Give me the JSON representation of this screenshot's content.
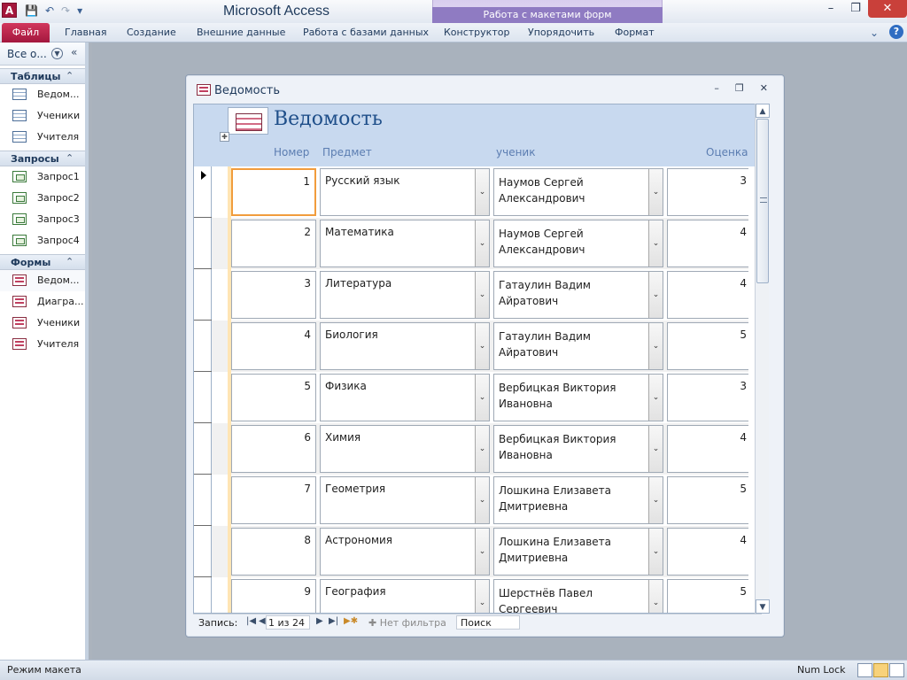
{
  "app": {
    "title": "Microsoft Access",
    "context_group": "Работа с макетами форм",
    "icon_letter": "A"
  },
  "ribbon": {
    "file": "Файл",
    "tabs": [
      "Главная",
      "Создание",
      "Внешние данные",
      "Работа с базами данных",
      "Конструктор",
      "Упорядочить",
      "Формат"
    ]
  },
  "nav": {
    "header": "Все о...",
    "groups": [
      {
        "title": "Таблицы",
        "items": [
          "Ведом...",
          "Ученики",
          "Учителя"
        ]
      },
      {
        "title": "Запросы",
        "items": [
          "Запрос1",
          "Запрос2",
          "Запрос3",
          "Запрос4"
        ]
      },
      {
        "title": "Формы",
        "items": [
          "Ведом...",
          "Диагра...",
          "Ученики",
          "Учителя"
        ]
      }
    ]
  },
  "form": {
    "window_title": "Ведомость",
    "header_title": "Ведомость",
    "columns": {
      "num": "Номер",
      "subject": "Предмет",
      "student": "ученик",
      "grade": "Оценка"
    },
    "records": [
      {
        "num": "1",
        "subject": "Русский язык",
        "student": "Наумов Сергей Александрович",
        "grade": "3"
      },
      {
        "num": "2",
        "subject": "Математика",
        "student": "Наумов Сергей Александрович",
        "grade": "4"
      },
      {
        "num": "3",
        "subject": "Литература",
        "student": "Гатаулин Вадим Айратович",
        "grade": "4"
      },
      {
        "num": "4",
        "subject": "Биология",
        "student": "Гатаулин Вадим Айратович",
        "grade": "5"
      },
      {
        "num": "5",
        "subject": "Физика",
        "student": "Вербицкая Виктория Ивановна",
        "grade": "3"
      },
      {
        "num": "6",
        "subject": "Химия",
        "student": "Вербицкая Виктория Ивановна",
        "grade": "4"
      },
      {
        "num": "7",
        "subject": "Геометрия",
        "student": "Лошкина Елизавета Дмитриевна",
        "grade": "5"
      },
      {
        "num": "8",
        "subject": "Астрономия",
        "student": "Лошкина Елизавета Дмитриевна",
        "grade": "4"
      },
      {
        "num": "9",
        "subject": "География",
        "student": "Шерстнёв Павел Сергеевич",
        "grade": "5"
      }
    ],
    "record_nav": {
      "label": "Запись:",
      "current": "1 из 24",
      "filter": "Нет фильтра",
      "search": "Поиск"
    }
  },
  "status": {
    "mode": "Режим макета",
    "numlock": "Num Lock"
  }
}
